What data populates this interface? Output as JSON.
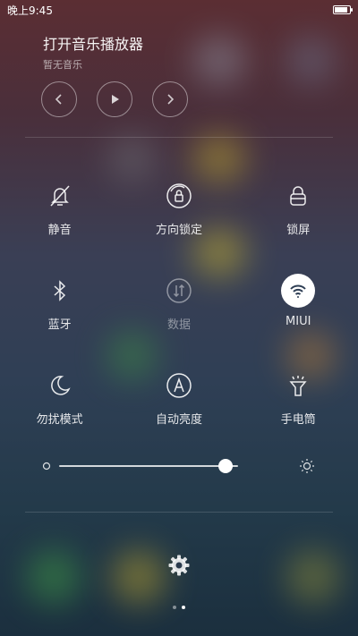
{
  "status": {
    "time": "晚上9:45"
  },
  "music": {
    "title": "打开音乐播放器",
    "subtitle": "暂无音乐"
  },
  "toggles": [
    {
      "label": "静音",
      "icon": "bell-off-icon",
      "active": false
    },
    {
      "label": "方向锁定",
      "icon": "rotation-lock-icon",
      "active": false
    },
    {
      "label": "锁屏",
      "icon": "lock-icon",
      "active": false
    },
    {
      "label": "蓝牙",
      "icon": "bluetooth-icon",
      "active": false
    },
    {
      "label": "数据",
      "icon": "mobile-data-icon",
      "active": false
    },
    {
      "label": "MIUI",
      "icon": "wifi-icon",
      "active": true
    },
    {
      "label": "勿扰模式",
      "icon": "moon-icon",
      "active": false
    },
    {
      "label": "自动亮度",
      "icon": "auto-brightness-icon",
      "active": false
    },
    {
      "label": "手电筒",
      "icon": "flashlight-icon",
      "active": false
    }
  ],
  "brightness": {
    "level": 0.93
  },
  "pager": {
    "pages": 2,
    "current": 2
  },
  "colors": {
    "accent": "#ffffff",
    "background": "#2f3f55"
  }
}
